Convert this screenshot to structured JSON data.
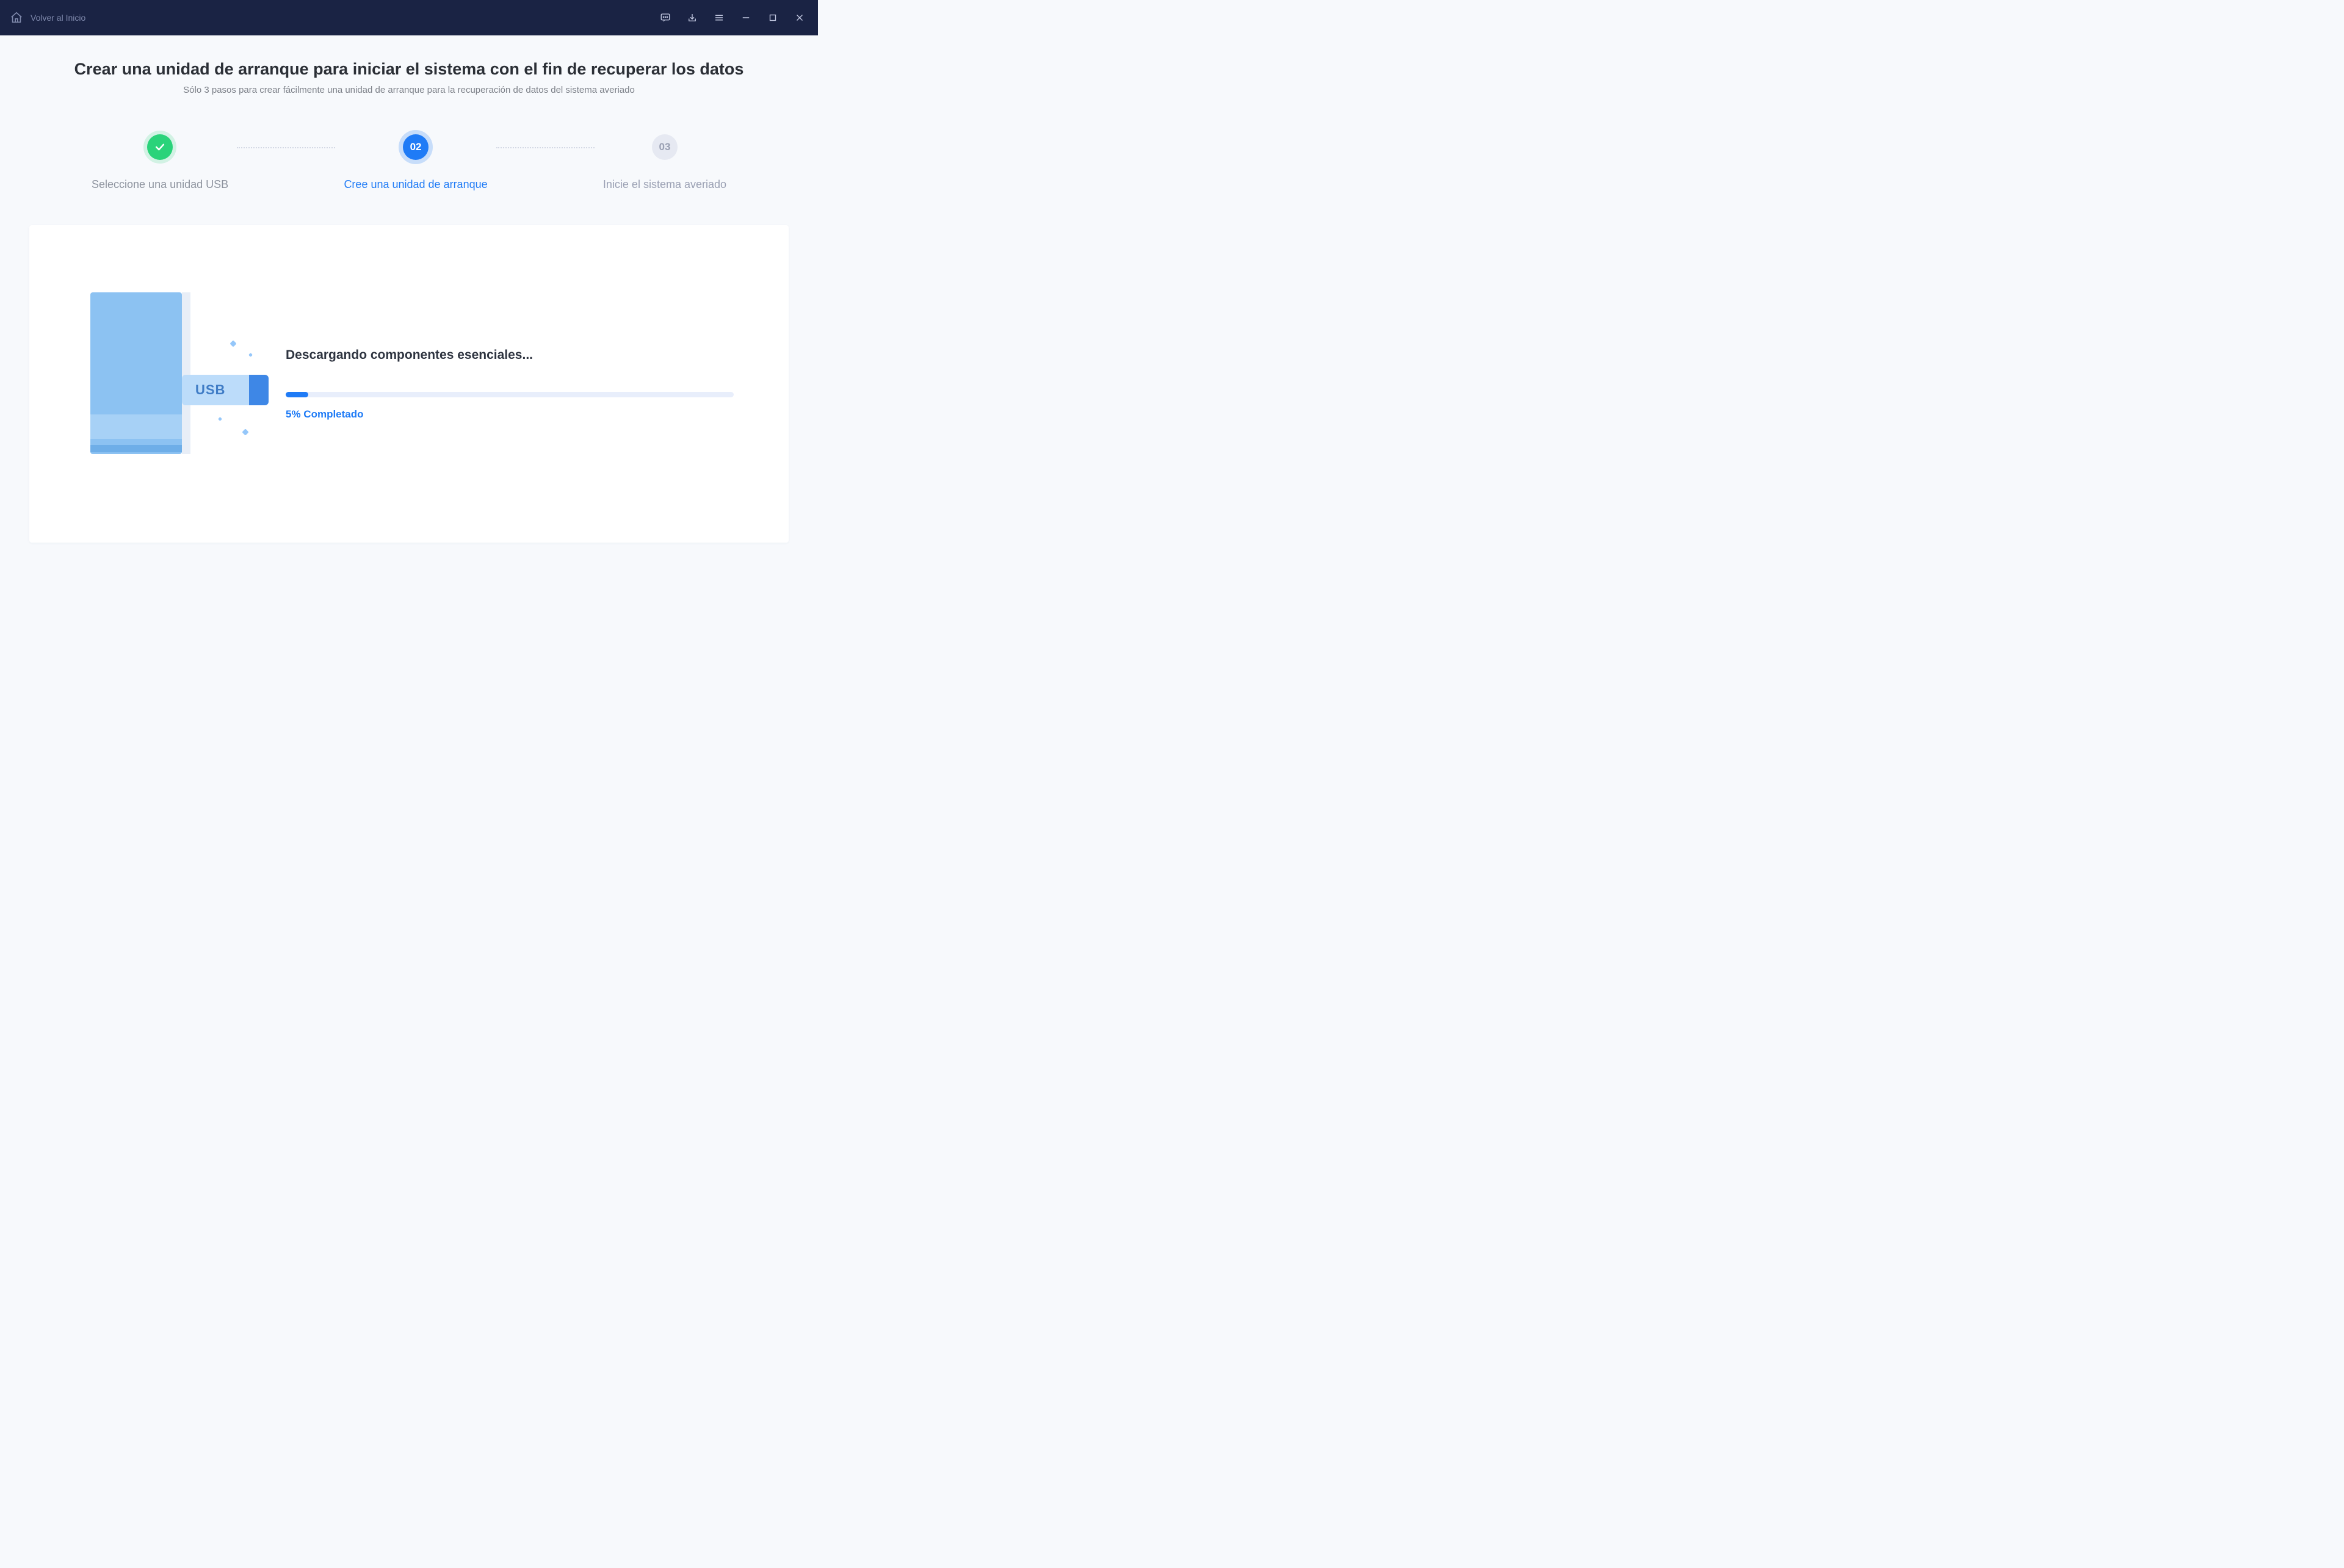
{
  "titlebar": {
    "home_label": "Volver al Inicio"
  },
  "header": {
    "title": "Crear una unidad de arranque para iniciar el sistema con el fin de recuperar los datos",
    "subtitle": "Sólo 3 pasos para crear fácilmente una unidad de arranque para la recuperación de datos del sistema averiado"
  },
  "steps": {
    "s1": {
      "label": "Seleccione una unidad USB"
    },
    "s2": {
      "num": "02",
      "label": "Cree una unidad de arranque"
    },
    "s3": {
      "num": "03",
      "label": "Inicie el sistema averiado"
    }
  },
  "progress": {
    "title": "Descargando componentes esenciales...",
    "percent": 5,
    "caption": "5% Completado"
  },
  "illustration": {
    "usb_label": "USB"
  }
}
